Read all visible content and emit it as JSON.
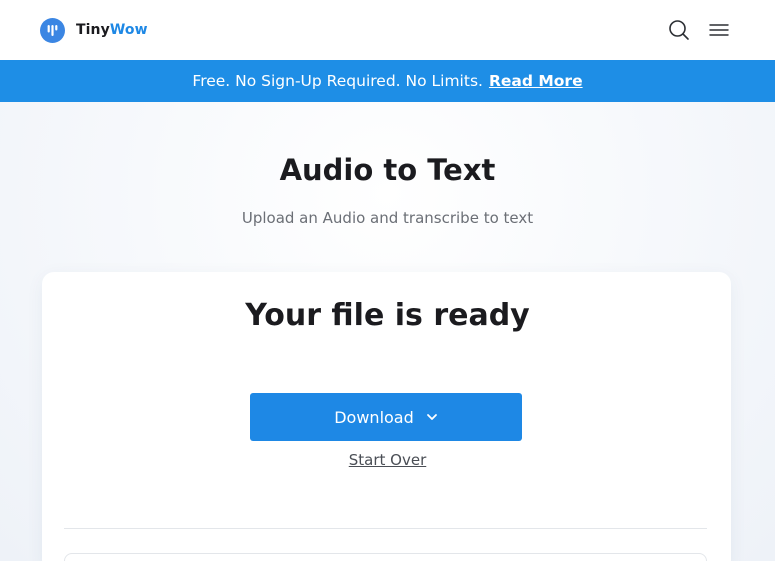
{
  "brand": {
    "name_part1": "Tiny",
    "name_part2": "Wow"
  },
  "header": {
    "search_icon": "search-icon",
    "menu_icon": "hamburger-menu-icon"
  },
  "banner": {
    "text": "Free. No Sign-Up Required. No Limits.",
    "link_label": "Read More"
  },
  "page": {
    "title": "Audio to Text",
    "subtitle": "Upload an Audio and transcribe to text"
  },
  "result": {
    "title": "Your file is ready",
    "download_label": "Download",
    "start_over_label": "Start Over"
  },
  "colors": {
    "accent": "#1e88e5",
    "banner": "#1e8ee6",
    "text": "#1b1b1f",
    "muted": "#6b6f76"
  }
}
